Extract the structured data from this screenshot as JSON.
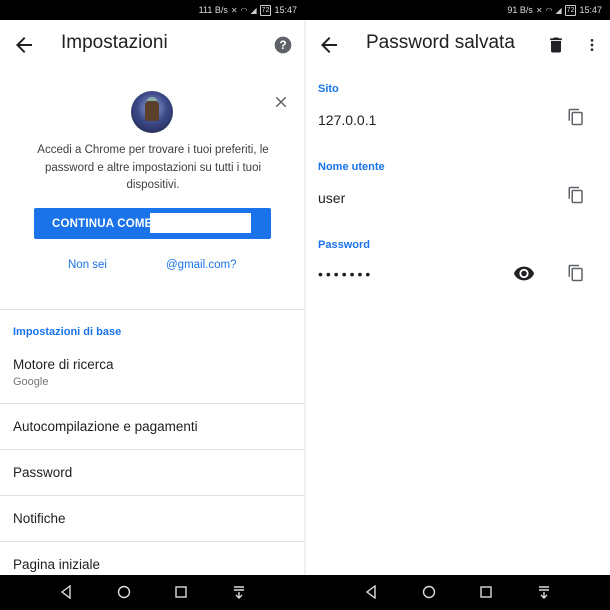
{
  "left": {
    "status": {
      "speed": "111 B/s",
      "battery": "72",
      "time": "15:47"
    },
    "title": "Impostazioni",
    "signin": {
      "message": "Accedi a Chrome per trovare i tuoi preferiti, le password e altre impostazioni su tutti i tuoi dispositivi.",
      "continue_label": "CONTINUA COME",
      "not_you_prefix": "Non sei",
      "not_you_suffix": "@gmail.com?"
    },
    "section_basic": "Impostazioni di base",
    "items": [
      {
        "title": "Motore di ricerca",
        "subtitle": "Google"
      },
      {
        "title": "Autocompilazione e pagamenti"
      },
      {
        "title": "Password"
      },
      {
        "title": "Notifiche"
      },
      {
        "title": "Pagina iniziale"
      }
    ]
  },
  "right": {
    "status": {
      "speed": "91 B/s",
      "battery": "72",
      "time": "15:47"
    },
    "title": "Password salvata",
    "fields": [
      {
        "label": "Sito",
        "value": "127.0.0.1"
      },
      {
        "label": "Nome utente",
        "value": "user"
      },
      {
        "label": "Password",
        "value": "•••••••"
      }
    ]
  },
  "colors": {
    "accent": "#1a73e8",
    "text": "#202124",
    "statusbar": "#000000"
  },
  "icons": [
    "back-arrow-icon",
    "help-icon",
    "close-icon",
    "trash-icon",
    "more-vert-icon",
    "copy-icon",
    "eye-icon",
    "nav-back-icon",
    "nav-home-icon",
    "nav-recents-icon",
    "nav-notifications-icon"
  ]
}
